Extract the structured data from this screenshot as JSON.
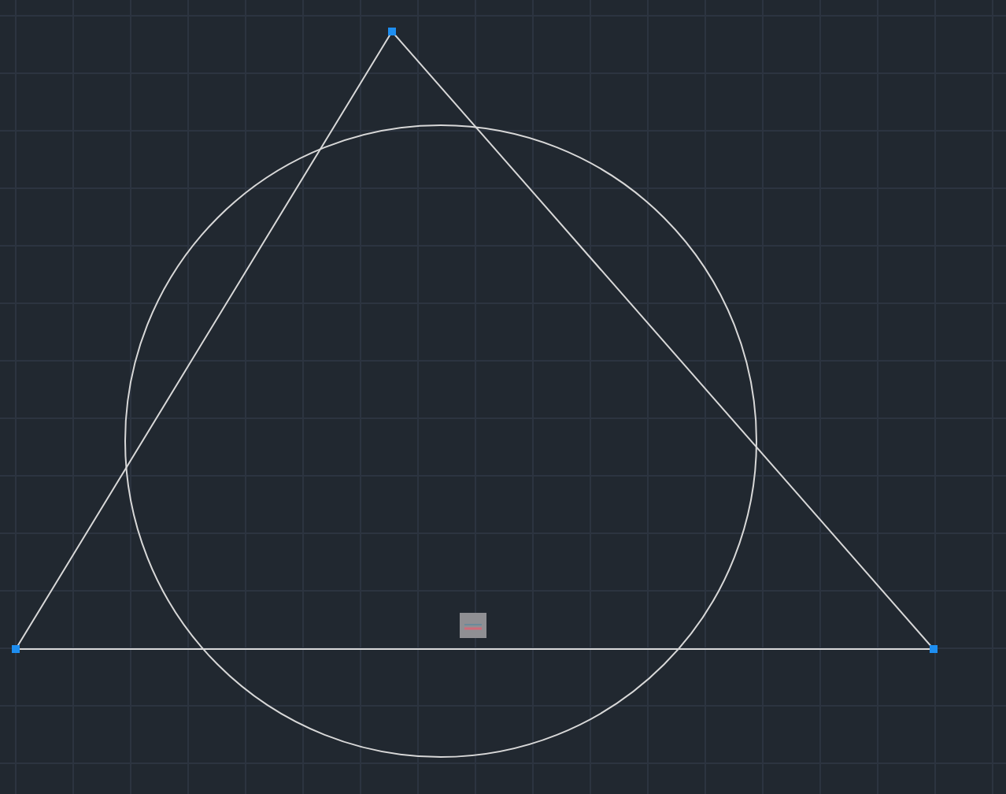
{
  "drawing": {
    "grid": true
  }
}
